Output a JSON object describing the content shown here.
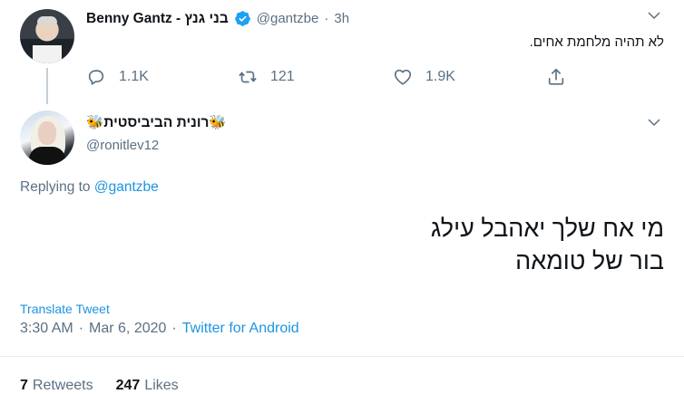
{
  "tweet1": {
    "display_name": "Benny Gantz - בני גנץ",
    "handle": "@gantzbe",
    "separator": "·",
    "time": "3h",
    "text": "לא תהיה מלחמת אחים.",
    "replies": "1.1K",
    "retweets": "121",
    "likes": "1.9K"
  },
  "tweet2": {
    "display_name": "🐝רונית הביביסטית🐝",
    "handle": "@ronitlev12",
    "replying_label": "Replying to",
    "replying_handle": "@gantzbe",
    "text_line1": "מי אח שלך יאהבל עילג",
    "text_line2": "בור של טומאה",
    "translate": "Translate Tweet",
    "time": "3:30 AM",
    "date": "Mar 6, 2020",
    "client": "Twitter for Android",
    "dot": "·",
    "retweets_count": "7",
    "retweets_label": "Retweets",
    "likes_count": "247",
    "likes_label": "Likes"
  },
  "icons": {
    "verified": "verified-badge-icon",
    "reply": "reply-icon",
    "retweet": "retweet-icon",
    "like": "heart-icon",
    "share": "share-icon",
    "more": "chevron-down-icon"
  },
  "colors": {
    "accent": "#1b95e0",
    "muted": "#5b7083",
    "verified": "#1da1f2"
  }
}
